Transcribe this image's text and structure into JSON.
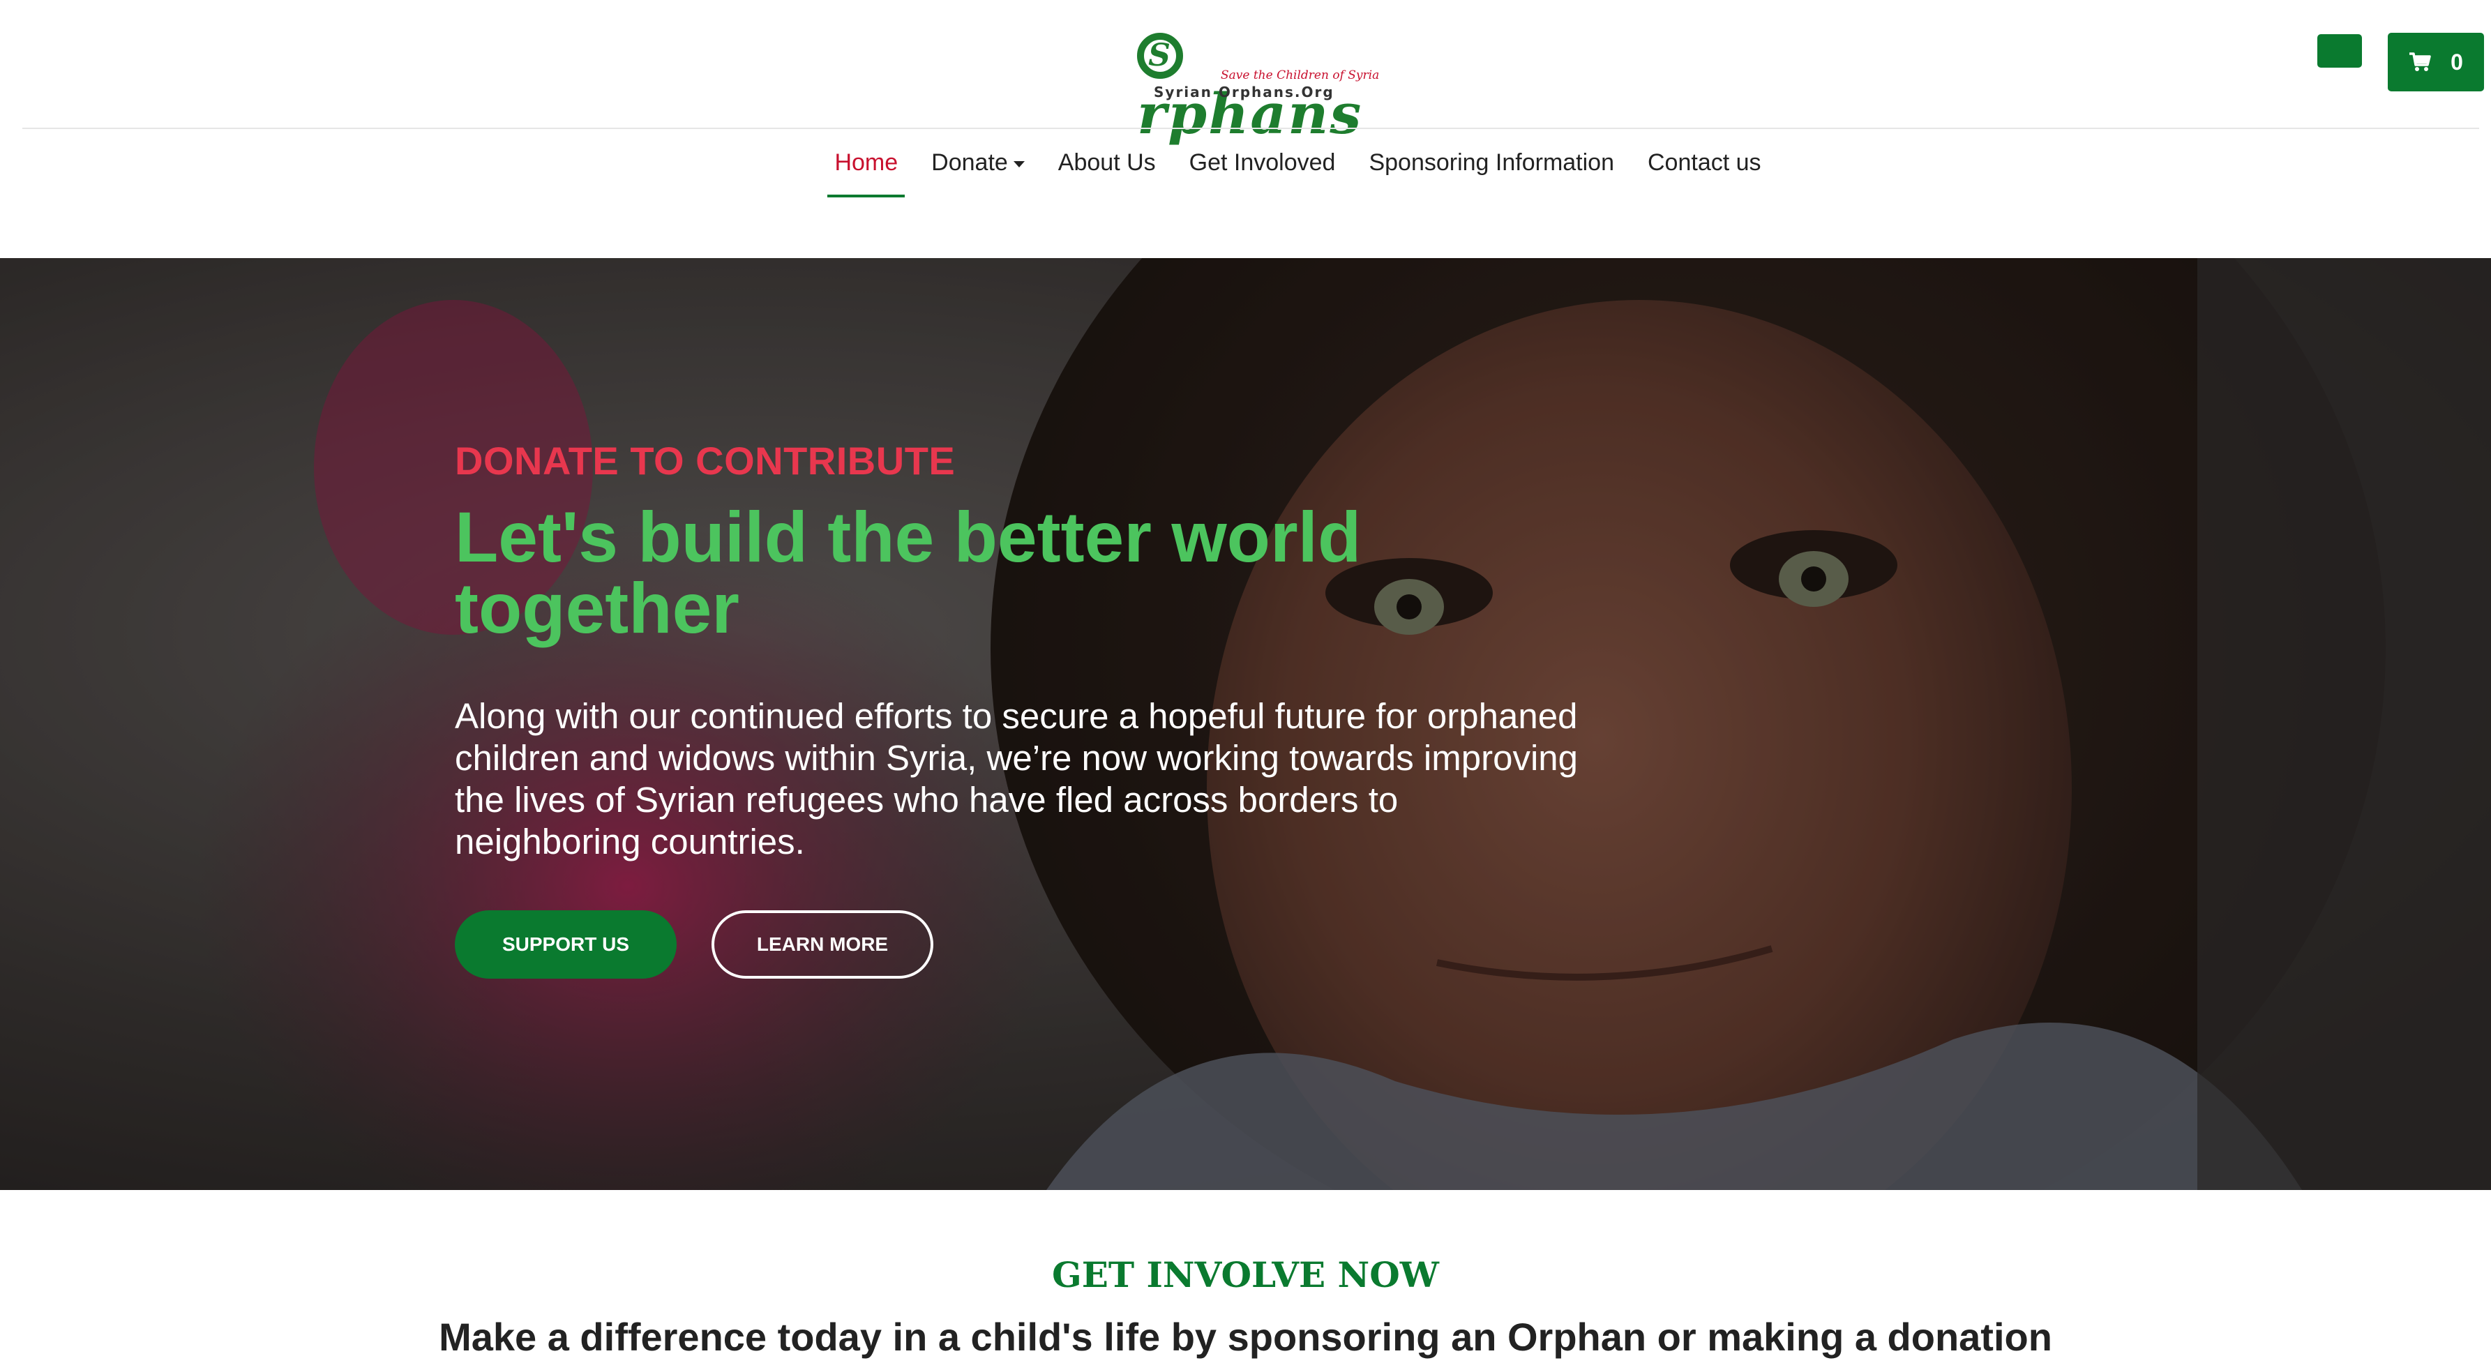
{
  "header": {
    "logo": {
      "word": "rphans",
      "initial": "S",
      "tagline": "Save the Children of Syria",
      "site": "Syrian Orphans.Org"
    },
    "cart": {
      "count": "0",
      "icon": "cart-icon"
    },
    "language_button_icon": "language-flag-icon"
  },
  "nav": {
    "items": [
      {
        "label": "Home",
        "active": true
      },
      {
        "label": "Donate",
        "dropdown": true
      },
      {
        "label": "About Us"
      },
      {
        "label": "Get Involoved"
      },
      {
        "label": "Sponsoring Information"
      },
      {
        "label": "Contact us"
      }
    ]
  },
  "hero": {
    "eyebrow": "DONATE TO CONTRIBUTE",
    "headline": "Let's build the better world together",
    "lead": "Along with our continued efforts to secure a hopeful future for orphaned children and widows within Syria, we’re now working towards improving the lives of Syrian refugees who have fled across borders to neighboring countries.",
    "primary_button": "SUPPORT US",
    "secondary_button": "LEARN MORE"
  },
  "involve": {
    "title": "GET INVOLVE NOW",
    "subtitle": "Make a difference today in a child's life by sponsoring an Orphan or making a donation"
  },
  "colors": {
    "brand_green": "#0a7a2f",
    "accent_red": "#c8102e",
    "headline_green": "#4cc45e",
    "eyebrow_red": "#e8374e"
  }
}
